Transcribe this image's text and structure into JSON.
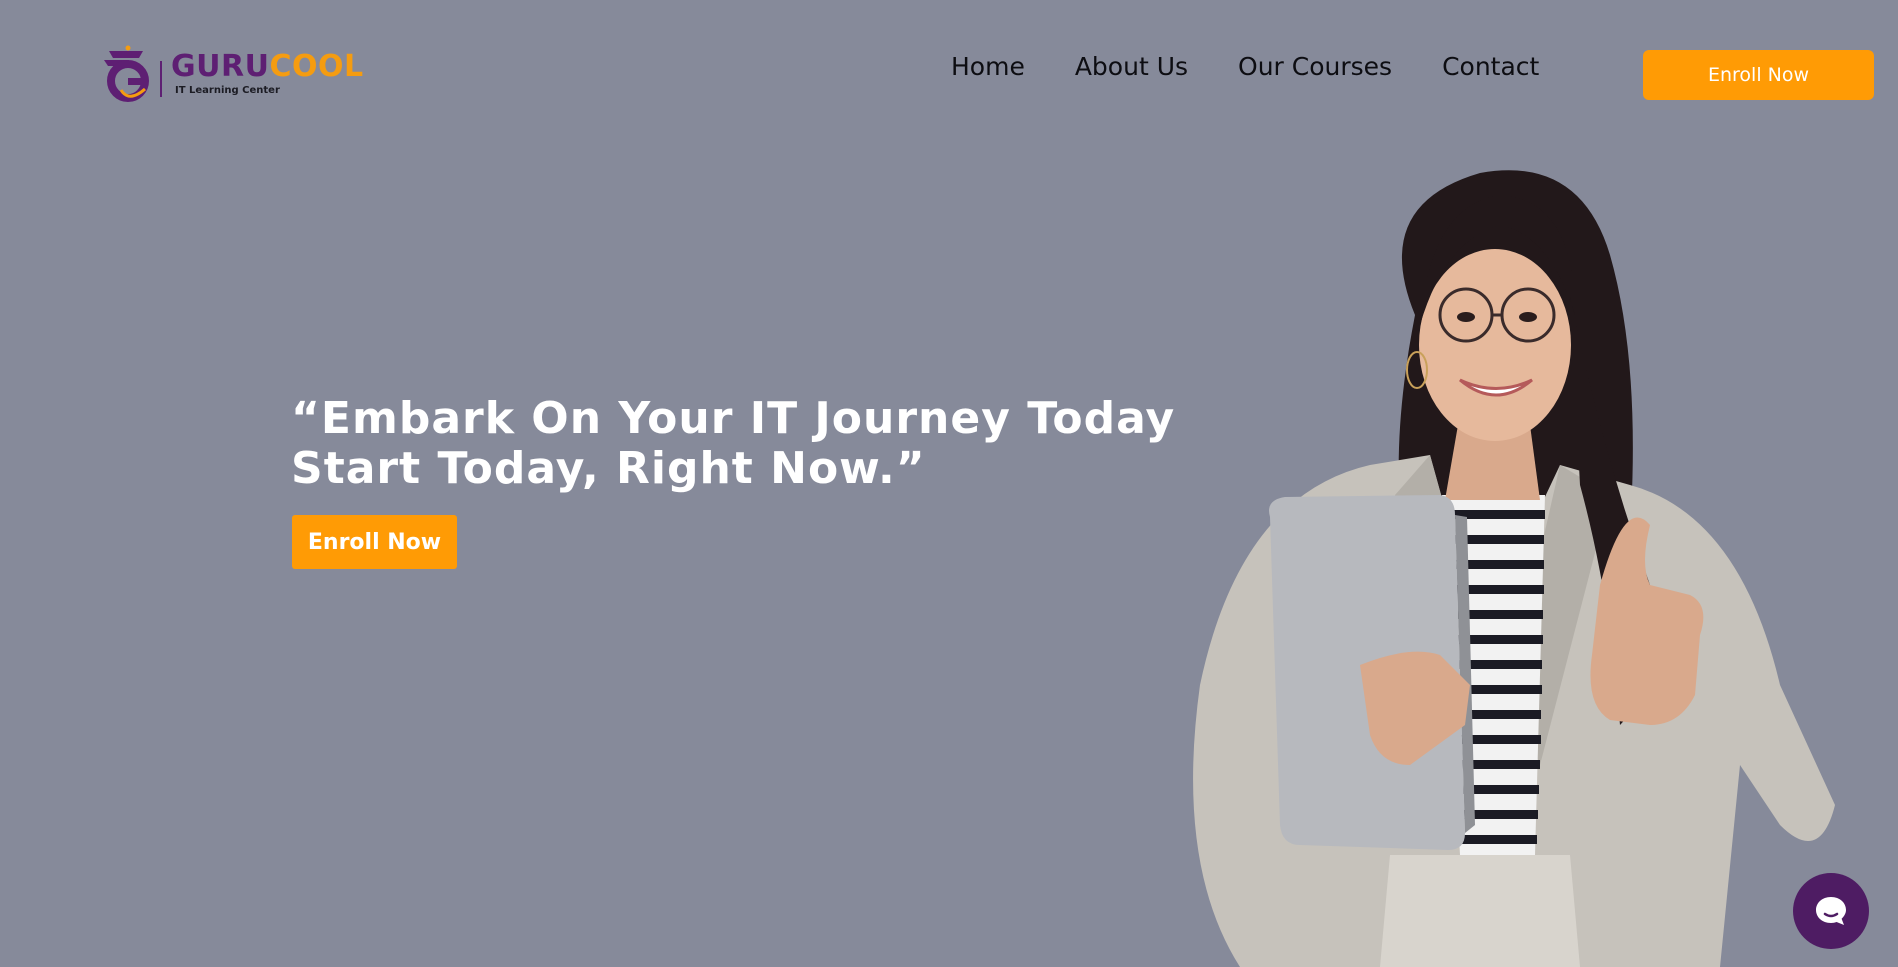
{
  "brand": {
    "name_part1": "GURU",
    "name_part2": "COOL",
    "tagline": "IT Learning Center",
    "logo_icon": "g-swoosh-logo-icon",
    "primary_color": "#5e1f73",
    "accent_color": "#f59c10"
  },
  "nav": {
    "items": [
      {
        "label": "Home"
      },
      {
        "label": "About Us"
      },
      {
        "label": "Our Courses"
      },
      {
        "label": "Contact"
      }
    ],
    "cta_label": "Enroll Now"
  },
  "hero": {
    "heading_line1": "“Embark On Your IT Journey Today",
    "heading_line2": "Start Today, Right Now.”",
    "cta_label": "Enroll Now",
    "image": "woman-holding-laptop-thumbs-up"
  },
  "chat": {
    "icon": "chat-bubble-icon"
  },
  "colors": {
    "background": "#868a9a",
    "button": "#ff9b05",
    "chat_widget": "#4e1c63"
  }
}
